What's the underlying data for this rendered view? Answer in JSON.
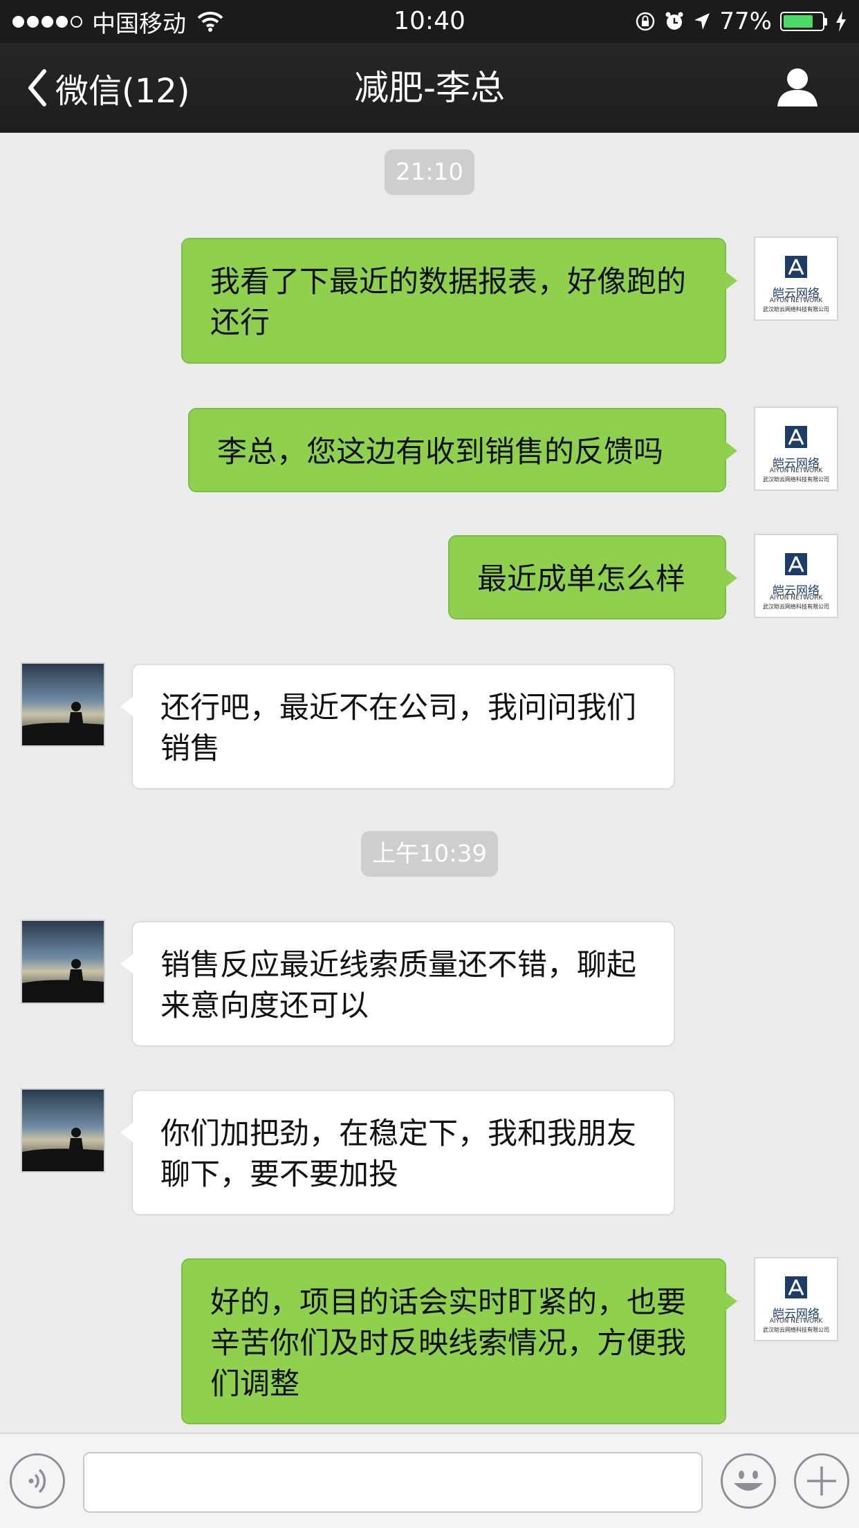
{
  "status_bar": {
    "carrier": "中国移动",
    "time": "10:40",
    "battery_text": "77%",
    "battery_level": 0.77
  },
  "nav": {
    "back_label": "微信(12)",
    "title": "减肥-李总"
  },
  "logo": {
    "cn": "皑云网络",
    "en": "AIYUN NETWORK",
    "foot": "武汉皑云网络科技有限公司"
  },
  "messages": [
    {
      "type": "time",
      "text": "21:10"
    },
    {
      "type": "sent",
      "text": "我看了下最近的数据报表，好像跑的还行"
    },
    {
      "type": "sent",
      "text": "李总，您这边有收到销售的反馈吗"
    },
    {
      "type": "sent",
      "text": "最近成单怎么样"
    },
    {
      "type": "received",
      "text": "还行吧，最近不在公司，我问问我们销售"
    },
    {
      "type": "time",
      "text": "上午10:39"
    },
    {
      "type": "received",
      "text": "销售反应最近线索质量还不错，聊起来意向度还可以"
    },
    {
      "type": "received",
      "text": "你们加把劲，在稳定下，我和我朋友聊下，要不要加投"
    },
    {
      "type": "sent",
      "text": "好的，项目的话会实时盯紧的，也要辛苦你们及时反映线索情况，方便我们调整"
    }
  ],
  "input": {
    "value": ""
  },
  "colors": {
    "sent_bubble": "#8fd14f",
    "received_bubble": "#ffffff",
    "chat_background": "#ebebeb",
    "nav_background": "#262628"
  }
}
